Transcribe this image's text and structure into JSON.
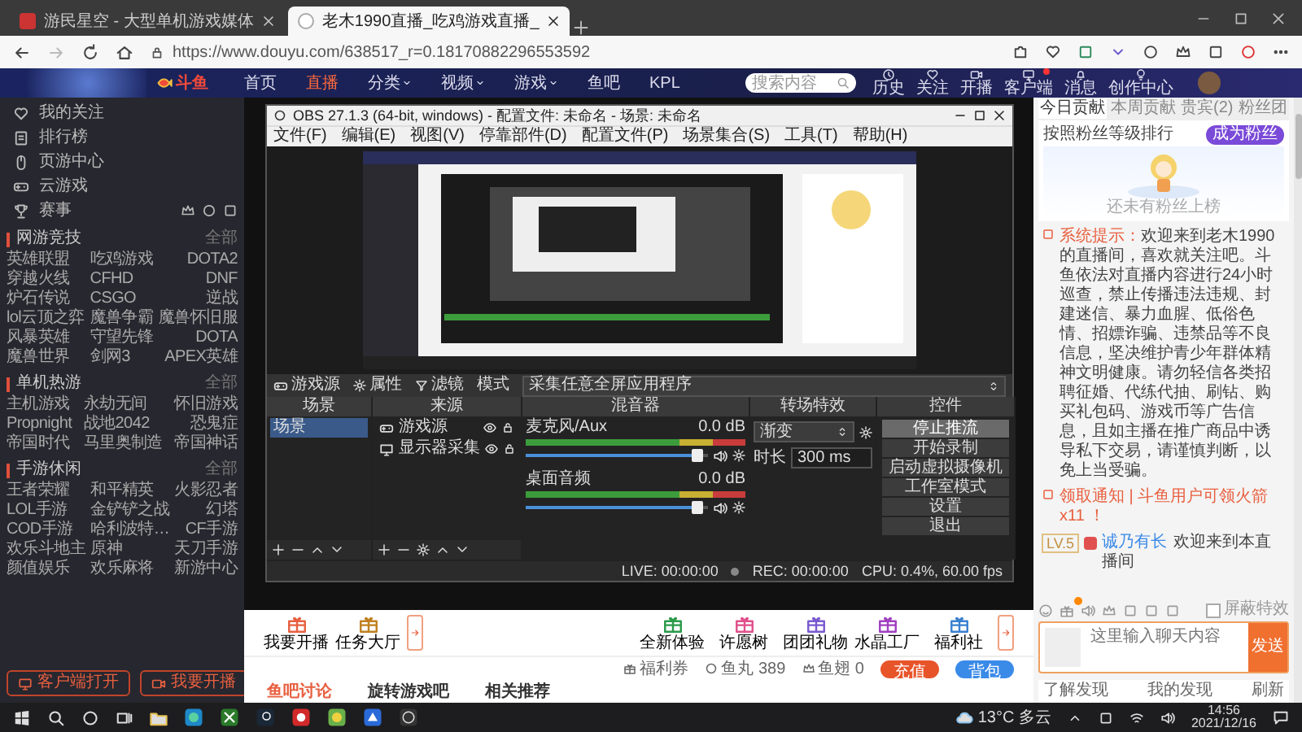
{
  "browser": {
    "tabs": [
      {
        "title": "游民星空 - 大型单机游戏媒体",
        "selected": false
      },
      {
        "title": "老木1990直播_吃鸡游戏直播_",
        "selected": true
      }
    ],
    "url": "https://www.douyu.com/638517_r=0.18170882296553592"
  },
  "site_nav": {
    "logo": "斗鱼",
    "links": [
      {
        "label": "首页",
        "selected": false,
        "dropdown": false
      },
      {
        "label": "直播",
        "selected": true,
        "dropdown": false
      },
      {
        "label": "分类",
        "selected": false,
        "dropdown": true
      },
      {
        "label": "视频",
        "selected": false,
        "dropdown": true
      },
      {
        "label": "游戏",
        "selected": false,
        "dropdown": true
      },
      {
        "label": "鱼吧",
        "selected": false,
        "dropdown": false
      },
      {
        "label": "KPL",
        "selected": false,
        "dropdown": false
      }
    ],
    "search": {
      "placeholder": "搜索内容"
    },
    "actions": [
      {
        "label": "历史",
        "badge": false
      },
      {
        "label": "关注",
        "badge": false
      },
      {
        "label": "开播",
        "badge": false
      },
      {
        "label": "客户端",
        "badge": true
      },
      {
        "label": "消息",
        "badge": false
      },
      {
        "label": "创作中心",
        "badge": false
      }
    ]
  },
  "sidebar": {
    "items": [
      "我的关注",
      "排行榜",
      "页游中心",
      "云游戏",
      "赛事"
    ],
    "sections": [
      {
        "title": "网游竞技",
        "more": "全部",
        "games": [
          "英雄联盟",
          "吃鸡游戏",
          "DOTA2",
          "穿越火线",
          "CFHD",
          "DNF",
          "炉石传说",
          "CSGO",
          "逆战",
          "lol云顶之弈",
          "魔兽争霸",
          "魔兽怀旧服",
          "风暴英雄",
          "守望先锋",
          "DOTA",
          "魔兽世界",
          "剑网3",
          "APEX英雄"
        ]
      },
      {
        "title": "单机热游",
        "more": "全部",
        "games": [
          "主机游戏",
          "永劫无间",
          "怀旧游戏",
          "Propnight",
          "战地2042",
          "恐鬼症",
          "帝国时代",
          "马里奥制造",
          "帝国神话"
        ]
      },
      {
        "title": "手游休闲",
        "more": "全部",
        "games": [
          "王者荣耀",
          "和平精英",
          "火影忍者",
          "LOL手游",
          "金铲铲之战",
          "幻塔",
          "COD手游",
          "哈利波特…",
          "CF手游",
          "欢乐斗地主",
          "原神",
          "天刀手游",
          "颜值娱乐",
          "欢乐麻将",
          "新游中心"
        ]
      }
    ],
    "buttons": [
      "客户端打开",
      "我要开播"
    ]
  },
  "obs": {
    "title": "OBS 27.1.3 (64-bit, windows) - 配置文件: 未命名 - 场景: 未命名",
    "menu": [
      "文件(F)",
      "编辑(E)",
      "视图(V)",
      "停靠部件(D)",
      "配置文件(P)",
      "场景集合(S)",
      "工具(T)",
      "帮助(H)"
    ],
    "source_bar": {
      "source": "游戏源",
      "properties": "属性",
      "filters": "滤镜",
      "mode_label": "模式",
      "mode": "采集任意全屏应用程序"
    },
    "panels": [
      "场景",
      "来源",
      "混音器",
      "转场特效",
      "控件"
    ],
    "scenes": [
      {
        "name": "场景",
        "selected": true
      }
    ],
    "sources": [
      {
        "name": "游戏源",
        "visible": true,
        "locked": false
      },
      {
        "name": "显示器采集",
        "visible": true,
        "locked": false
      }
    ],
    "mixer": [
      {
        "name": "麦克风/Aux",
        "reading": "0.0 dB",
        "level": 0.95
      },
      {
        "name": "桌面音频",
        "reading": "0.0 dB",
        "level": 0.95
      }
    ],
    "transition": {
      "type": "渐变",
      "duration_label": "时长",
      "duration": "300 ms"
    },
    "controls": [
      {
        "label": "停止推流",
        "highlighted": true
      },
      {
        "label": "开始录制",
        "highlighted": false
      },
      {
        "label": "启动虚拟摄像机",
        "highlighted": false
      },
      {
        "label": "工作室模式",
        "highlighted": false
      },
      {
        "label": "设置",
        "highlighted": false
      },
      {
        "label": "退出",
        "highlighted": false
      }
    ],
    "status": {
      "live": "LIVE: 00:00:00",
      "rec": "REC: 00:00:00",
      "cpu": "CPU: 0.4%, 60.00 fps"
    }
  },
  "room": {
    "gifts_left": [
      "我要开播",
      "任务大厅"
    ],
    "gifts_right": [
      "全新体验",
      "许愿树",
      "团团礼物",
      "水晶工厂",
      "福利社"
    ],
    "wallet": [
      "福利券",
      "鱼丸 389",
      "鱼翅 0"
    ],
    "recharge": "充值",
    "backpack": "背包",
    "tabs": [
      "鱼吧讨论",
      "旋转游戏吧",
      "相关推荐"
    ]
  },
  "chat": {
    "tabs": [
      {
        "label": "今日贡献",
        "selected": true
      },
      {
        "label": "本周贡献",
        "selected": false
      },
      {
        "label": "贵宾(2)",
        "selected": false
      },
      {
        "label": "粉丝团",
        "selected": false
      }
    ],
    "fan_rank": {
      "title": "按照粉丝等级排行",
      "button": "成为粉丝",
      "empty": "还未有粉丝上榜"
    },
    "messages": [
      {
        "kind": "system",
        "tag": "系统提示：",
        "text": "欢迎来到老木1990的直播间，喜欢就关注吧。斗鱼依法对直播内容进行24小时巡查，禁止传播违法违规、封建迷信、暴力血腥、低俗色情、招嫖诈骗、违禁品等不良信息，坚决维护青少年群体精神文明健康。请勿轻信各类招聘征婚、代练代抽、刷钻、购买礼包码、游戏币等广告信息，且如主播在推广商品中诱导私下交易，请谨慎判断，以免上当受骗。"
      },
      {
        "kind": "notice",
        "text": "领取通知 | 斗鱼用户可领火箭x11 ！"
      },
      {
        "kind": "user",
        "level": "LV.5",
        "user": "诚乃有长",
        "text": "欢迎来到本直播间"
      }
    ],
    "filter": {
      "label": "屏蔽特效",
      "checked": false
    },
    "input": {
      "placeholder": "这里输入聊天内容",
      "send": "发送"
    },
    "footer": [
      "了解发现",
      "我的发现",
      "刷新"
    ]
  },
  "taskbar": {
    "weather": "13°C 多云",
    "time": "14:56",
    "date": "2021/12/16"
  }
}
